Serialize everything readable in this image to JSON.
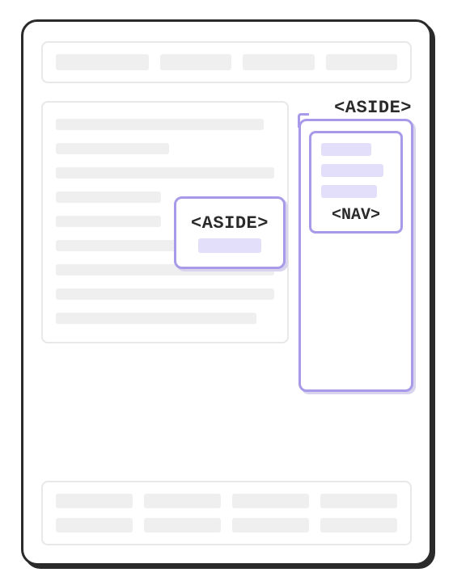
{
  "labels": {
    "aside_inline": "<ASIDE>",
    "aside_sidebar": "<ASIDE>",
    "nav": "<NAV>"
  },
  "colors": {
    "frame_border": "#2a2a2a",
    "highlight_border": "#a89ae8",
    "highlight_fill": "#e3defa",
    "placeholder_gray": "#efefef",
    "box_border_gray": "#e8e8e8"
  },
  "diagram": {
    "type": "html-semantic-layout",
    "elements": [
      "header",
      "main-content",
      "aside-inline",
      "aside-sidebar",
      "nav",
      "footer"
    ]
  }
}
